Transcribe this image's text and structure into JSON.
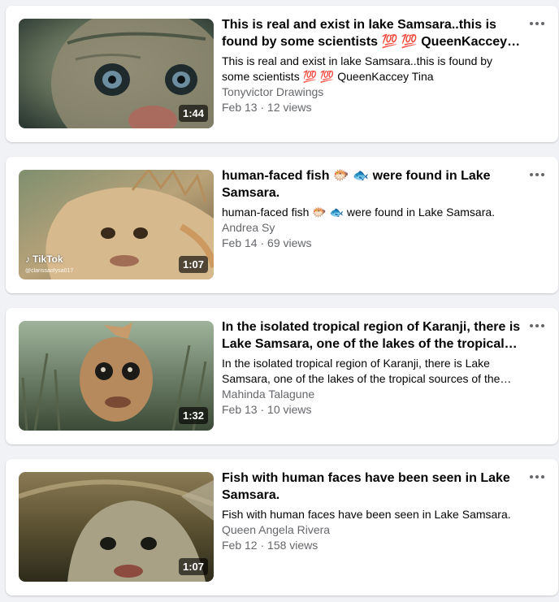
{
  "videos": [
    {
      "title": "This is real and exist in lake Samsara..this is found by some scientists 💯 💯 QueenKaccey Tina",
      "description": "This is real and exist in lake Samsara..this is found by some scientists 💯 💯 QueenKaccey Tina",
      "author": "Tonyvictor Drawings",
      "meta": "Feb 13 · 12 views",
      "duration": "1:44"
    },
    {
      "title": "human-faced fish 🐡 🐟 were found in Lake Samsara.",
      "description": "human-faced fish 🐡 🐟 were found in Lake Samsara.",
      "author": "Andrea Sy",
      "meta": "Feb 14 · 69 views",
      "duration": "1:07",
      "watermark": "TikTok",
      "watermark_handle": "@clarissaofysa017"
    },
    {
      "title": "In the isolated tropical region of Karanji, there is Lake Samsara, one of the lakes of the tropical sources of the Ganges.",
      "description": "In the isolated tropical region of Karanji, there is Lake Samsara, one of the lakes of the tropical sources of the Ganges.",
      "author": "Mahinda Talagune",
      "meta": "Feb 13 · 10 views",
      "duration": "1:32"
    },
    {
      "title": "Fish with human faces have been seen in Lake Samsara.",
      "description": "Fish with human faces have been seen in Lake Samsara.",
      "author": "Queen Angela Rivera",
      "meta": "Feb 12 · 158 views",
      "duration": "1:07"
    }
  ],
  "icons": {
    "more": "more-horizontal-icon",
    "watermark": "tiktok-logo-icon"
  },
  "colors": {
    "card": "#ffffff",
    "background": "#f0f2f5",
    "secondary_text": "#65676b"
  }
}
